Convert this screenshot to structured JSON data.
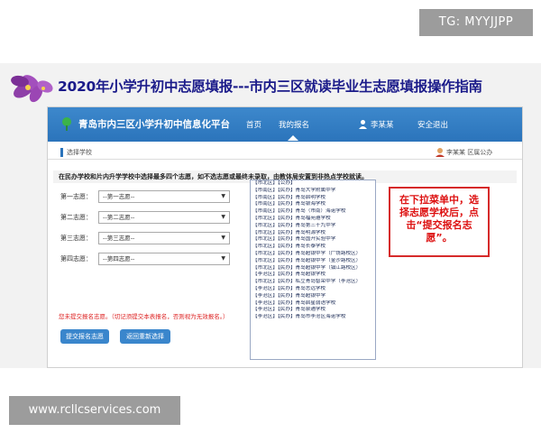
{
  "watermark_top": "TG: MYYJJPP",
  "watermark_bottom": "www.rcllcservices.com",
  "slide": {
    "title": "2020年小学升初中志愿填报---市内三区就读毕业生志愿填报操作指南"
  },
  "platform": {
    "title": "青岛市内三区小学升初中信息化平台",
    "nav": [
      "首页",
      "我的报名",
      "李某某",
      "安全退出"
    ],
    "active_nav_index": 1
  },
  "breadcrumb": "选择学校",
  "user_info": "李某某  区属公办",
  "info_text": "在民办学校和片内升学学校中选择最多四个志愿，如不选志愿或最终未录取，由教体局安置到非热点学校就读。",
  "choices": [
    {
      "label": "第一志愿：",
      "value": "--第一志愿--"
    },
    {
      "label": "第二志愿：",
      "value": "--第二志愿--"
    },
    {
      "label": "第三志愿：",
      "value": "--第三志愿--"
    },
    {
      "label": "第四志愿：",
      "value": "--第四志愿--"
    }
  ],
  "warning": "您未提交报名志愿。（切记须提交本表报名，否则视为无效报名。）",
  "buttons": {
    "submit": "提交报名志愿",
    "back": "返回重新选择"
  },
  "dropdown_items": [
    "【市北区】【公办】",
    "【市南区】【民办】青岛大学附属中学",
    "【市南区】【民办】青岛启明学校",
    "【市南区】【民办】青岛银海学校",
    "【市南区】【民办】青岛（市南）海诺学校",
    "【市北区】【民办】青岛福苑遵学校",
    "【市北区】【民办】青岛第三十九中学",
    "【市北区】【民办】青岛明源学校",
    "【市北区】【民办】青岛国开实验中学",
    "【市北区】【民办】青岛长泰学校",
    "【市北区】【民办】青岛超银中学（广饶路校区）",
    "【市北区】【民办】青岛超银中学（金沙路校区）",
    "【市北区】【民办】青岛超银中学（镇江路校区）",
    "【李沧区】【民办】青岛超银学校",
    "【市北区】【民办】私立青岛智荣中学（李沧区）",
    "【李沧区】【民办】青岛志远学校",
    "【李沧区】【民办】青岛超银中学",
    "【李沧区】【民办】青岛启星弱语学校",
    "【李沧区】【民办】青岛泉通学校",
    "【李沧区】【民办】青岛市李沧区海诺学校"
  ],
  "callout": "在下拉菜单中，选择志愿学校后，点击“提交报名志愿”。",
  "colors": {
    "header_blue": "#2b74bb",
    "title_navy": "#1b1b8a",
    "callout_red": "#d62a2a"
  }
}
